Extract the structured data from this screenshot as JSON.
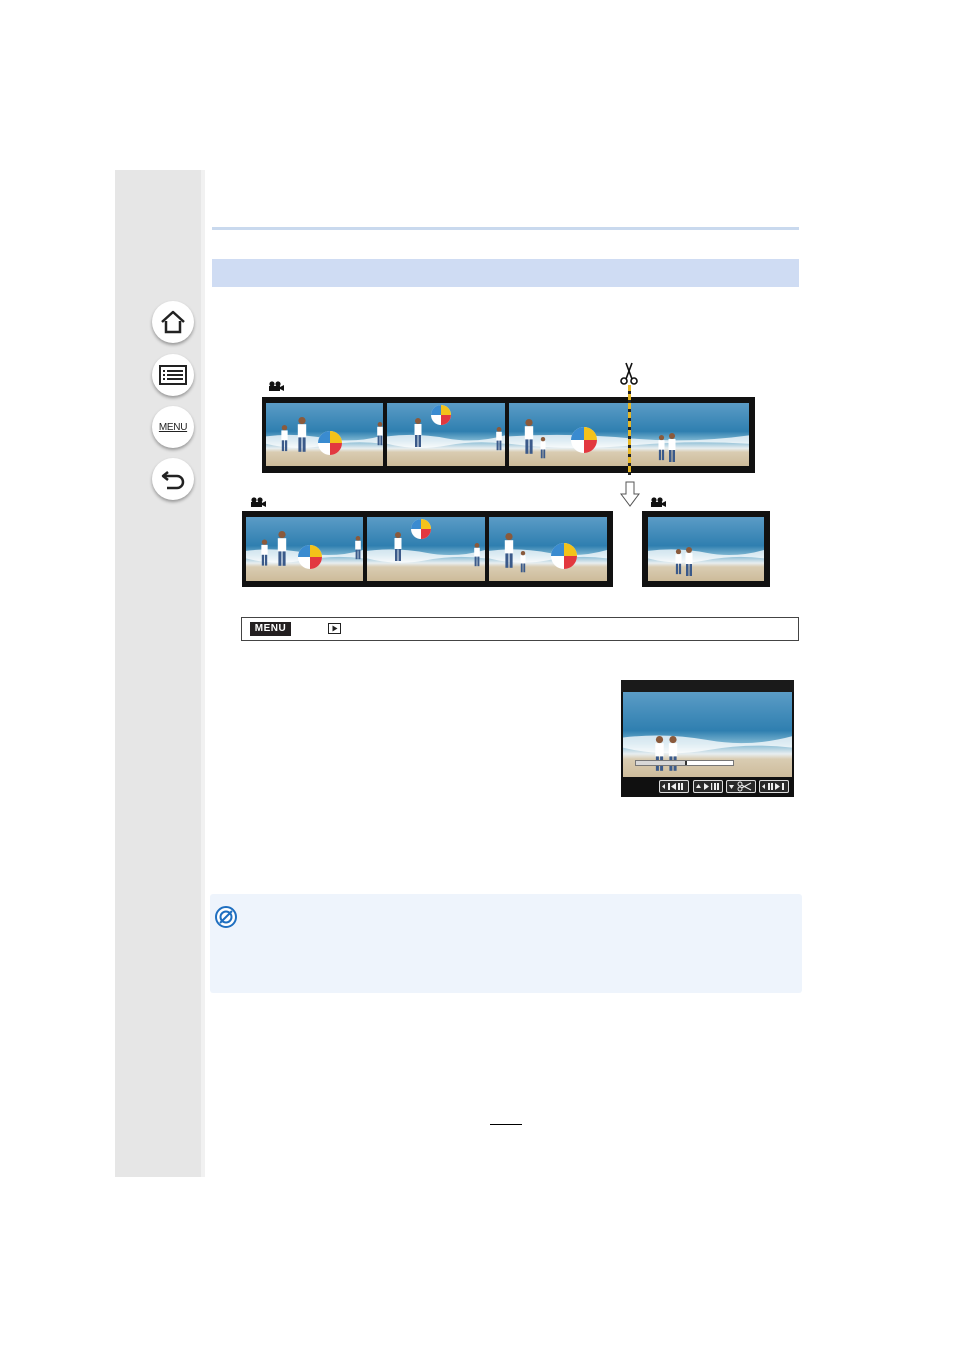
{
  "sidebar": {
    "buttons": [
      {
        "name": "home",
        "icon": "home-icon"
      },
      {
        "name": "contents",
        "icon": "list-icon"
      },
      {
        "name": "menu",
        "icon": "menu-icon",
        "label": "MENU"
      },
      {
        "name": "back",
        "icon": "back-arrow-icon"
      }
    ]
  },
  "diagram": {
    "original_icon": "movie-camera-icon",
    "cut_icon": "scissors-icon",
    "arrow_icon": "down-arrow-icon",
    "result_left_icon": "movie-camera-icon",
    "result_right_icon": "movie-camera-icon"
  },
  "menu_path": {
    "menu_label": "MENU",
    "playback_icon": "playback-icon"
  },
  "screen": {
    "progress": 0.5,
    "controls": [
      "rewind-button",
      "play-pause-button",
      "divide-button",
      "fast-forward-button"
    ]
  },
  "note": {
    "icon": "prohibited-icon"
  },
  "colors": {
    "sidebar": "#e6e6e6",
    "header_band": "#cfdcf3",
    "note_bg": "#eef4fc",
    "cut_line": "#e8b825"
  }
}
